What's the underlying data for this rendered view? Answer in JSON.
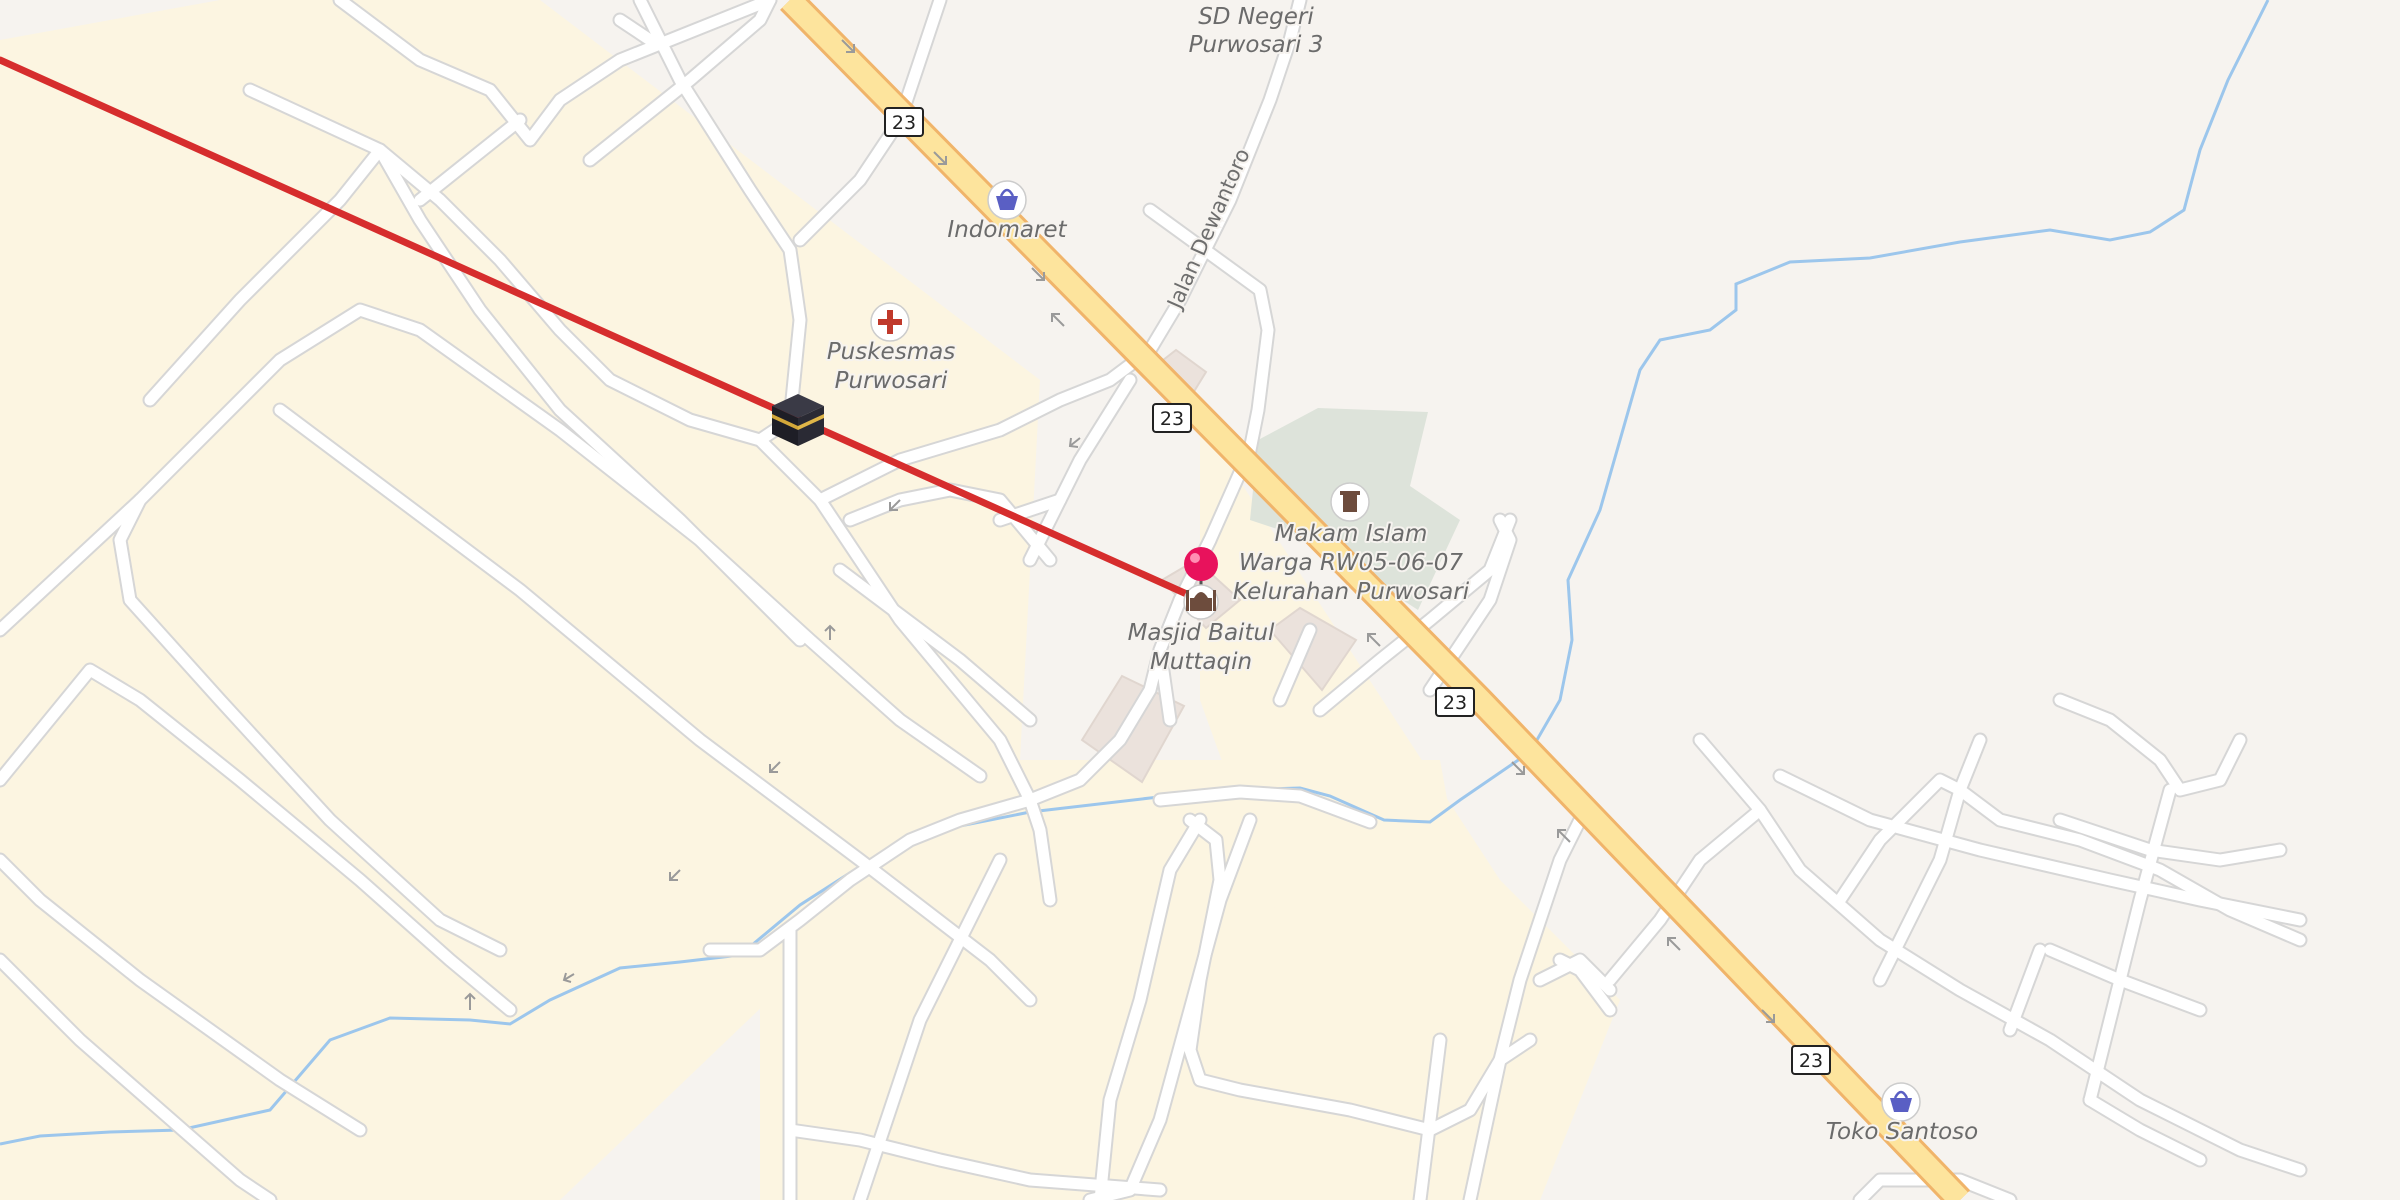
{
  "map": {
    "route_shield": "23",
    "street_labels": {
      "jalan_dewantoro": "Jalan Dewantoro"
    },
    "pois": {
      "sd_negeri": {
        "line1": "SD Negeri",
        "line2": "Purwosari 3"
      },
      "indomaret": {
        "label": "Indomaret",
        "icon": "shopping-basket-icon"
      },
      "puskesmas": {
        "line1": "Puskesmas",
        "line2": "Purwosari",
        "icon": "medical-cross-icon"
      },
      "makam": {
        "line1": "Makam Islam",
        "line2": "Warga RW05-06-07",
        "line3": "Kelurahan Purwosari",
        "icon": "cemetery-icon"
      },
      "masjid": {
        "line1": "Masjid Baitul",
        "line2": "Muttaqin",
        "icon": "mosque-icon"
      },
      "toko": {
        "label": "Toko Santoso",
        "icon": "shopping-basket-icon"
      }
    },
    "markers": {
      "kaaba": "kaaba-icon",
      "location_pin": "location-pin-icon"
    },
    "colors": {
      "background": "#f6f3ef",
      "residential": "#fcf5e1",
      "road": "#ffffff",
      "road_casing": "#d9d9d9",
      "primary_road": "#fde49d",
      "primary_casing": "#f0b46a",
      "water": "#9cc6ec",
      "cemetery": "#dde3da",
      "qibla_line": "#d62d2d",
      "pin": "#e8125c",
      "shop_icon": "#5a5fc4",
      "medical_icon": "#c0392b"
    }
  }
}
